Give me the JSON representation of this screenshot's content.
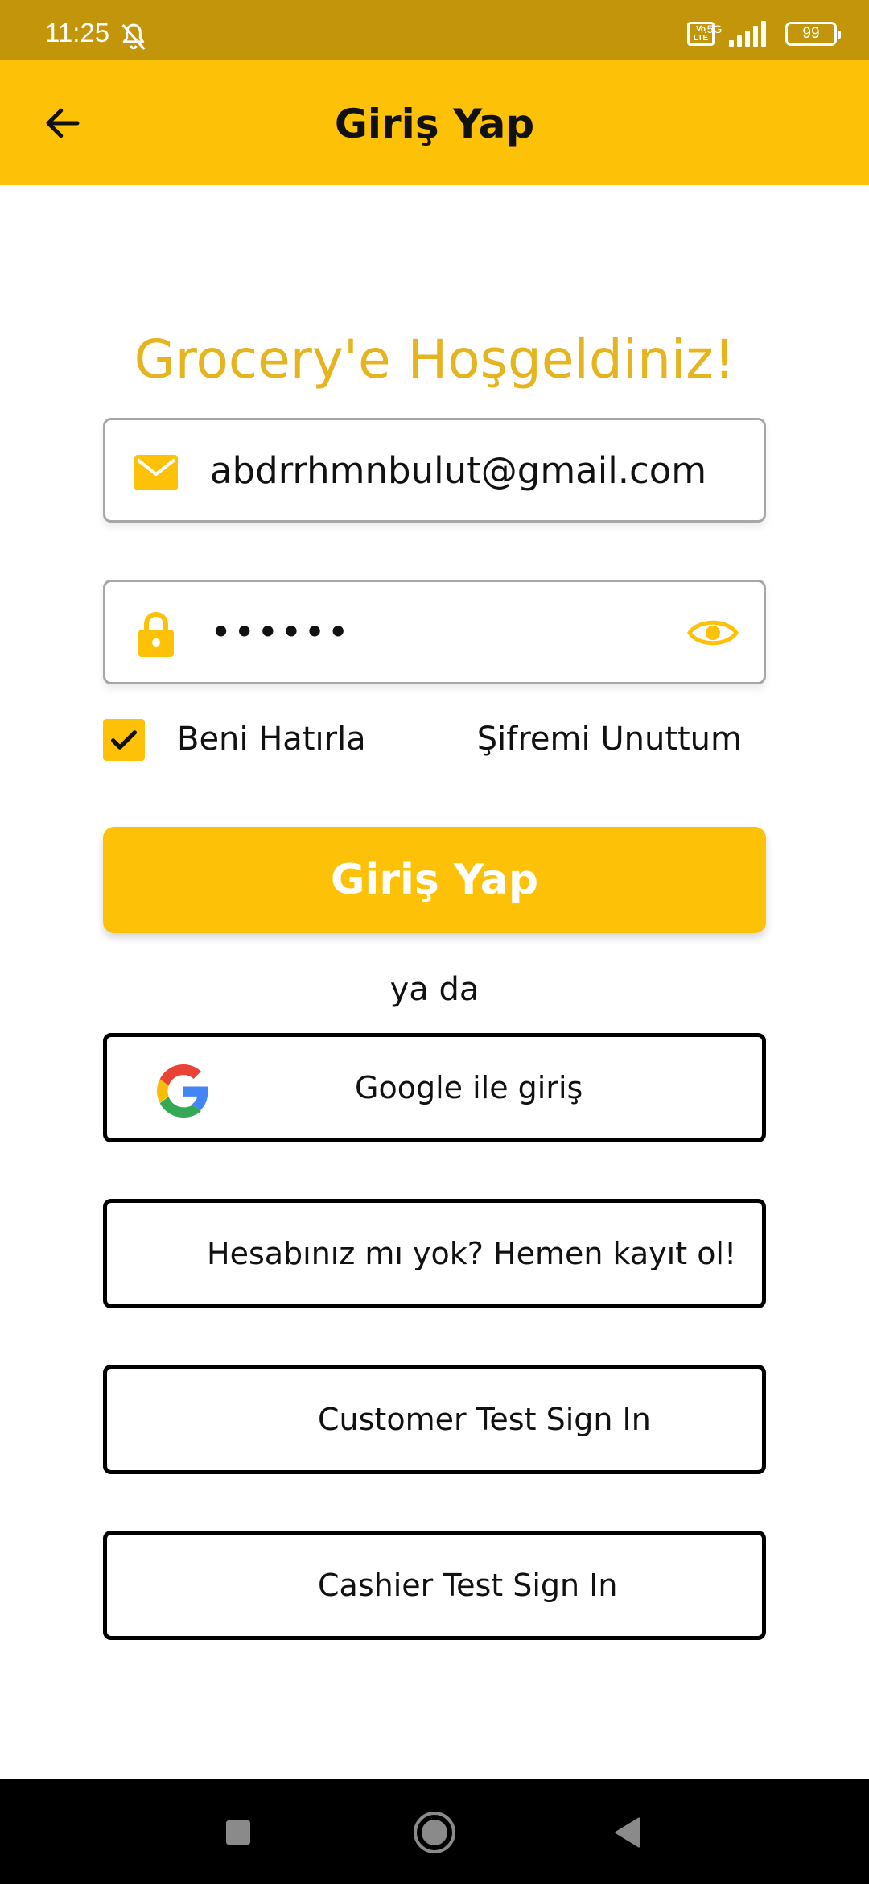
{
  "status_bar": {
    "time": "11:25",
    "volte_label": "Vo LTE",
    "network": "4.5G",
    "battery": "99"
  },
  "app_bar": {
    "title": "Giriş Yap",
    "back_icon": "arrow-left-icon"
  },
  "welcome": "Grocery'e Hoşgeldiniz!",
  "email_field": {
    "value": "abdrrhmnbulut@gmail.com",
    "icon": "mail-icon"
  },
  "password_field": {
    "value": "••••••",
    "icon": "lock-icon",
    "toggle_icon": "eye-icon"
  },
  "remember": {
    "label": "Beni Hatırla",
    "checked": true
  },
  "forgot_label": "Şifremi Unuttum",
  "login_button": "Giriş Yap",
  "or_text": "ya da",
  "google_button": "Google ile giriş",
  "register_button": "Hesabınız mı yok? Hemen kayıt ol!",
  "customer_test_button": "Customer Test Sign In",
  "cashier_test_button": "Cashier Test Sign In",
  "colors": {
    "accent": "#FDC108",
    "status_bar": "#C2950A",
    "welcome_text": "#E6B41F"
  }
}
